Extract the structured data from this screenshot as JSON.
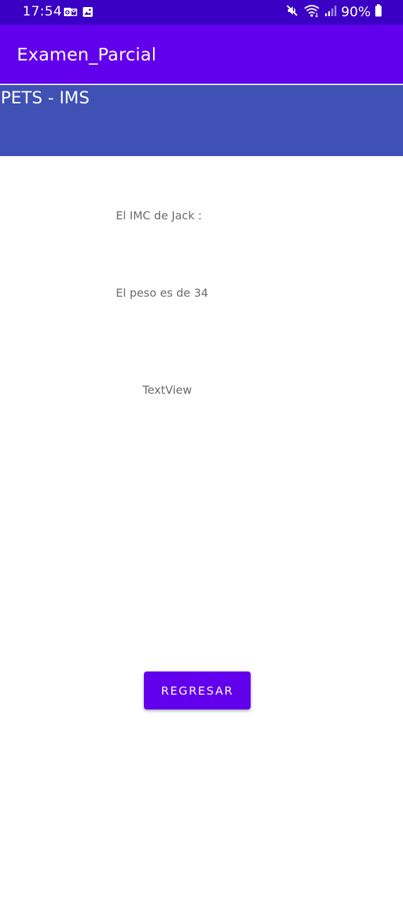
{
  "status_bar": {
    "time": "17:54",
    "battery": "90%",
    "background_color": "#3a00c4",
    "left_icons": [
      "outlook-icon",
      "gallery-icon"
    ],
    "right_icons": [
      "mute-icon",
      "wifi-icon",
      "signal-icon",
      "battery-icon"
    ]
  },
  "app_bar": {
    "title": "Examen_Parcial",
    "color": "#6200ee"
  },
  "header": {
    "title": "PETS - IMS",
    "color": "#3f51b5"
  },
  "content": {
    "imc_text": "El IMC de Jack :",
    "peso_text": "El peso es de 34",
    "placeholder_text": "TextView"
  },
  "actions": {
    "back_button_label": "REGRESAR"
  }
}
